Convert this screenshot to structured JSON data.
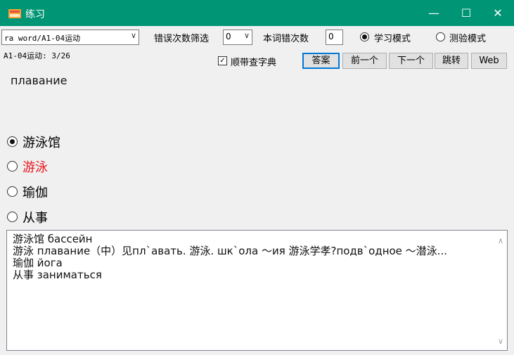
{
  "window": {
    "title": "练习",
    "minimize_glyph": "—",
    "maximize_glyph": "☐",
    "close_glyph": "✕"
  },
  "toolbar": {
    "word_list_selected": "ra word/A1-04运动",
    "error_filter_label": "错误次数筛选",
    "error_filter_value": "0",
    "word_error_count_label": "本词错次数",
    "word_error_count_value": "0",
    "mode_study_label": "学习模式",
    "mode_test_label": "测验模式",
    "mode_selected": "study"
  },
  "progress_text": "A1-04运动: 3/26",
  "dictionary_checkbox": {
    "label": "顺带查字典",
    "checked": true
  },
  "buttons": {
    "answer": "答案",
    "prev": "前一个",
    "next": "下一个",
    "jump": "跳转",
    "web": "Web"
  },
  "current_word": "плавание",
  "options": [
    {
      "text": "游泳馆",
      "selected": true
    },
    {
      "text": "游泳",
      "selected": false,
      "color": "#e8141b"
    },
    {
      "text": "瑜伽",
      "selected": false
    },
    {
      "text": "从事",
      "selected": false
    }
  ],
  "explanation_lines": [
    "游泳馆 бассейн",
    "游泳 плавание（中）见пл`авать. 游泳. шк`ола ～ия 游泳学孝?подв`одное ～潜泳...",
    "瑜伽 йога",
    "从事 заниматься"
  ],
  "colors": {
    "titlebar": "#009574",
    "wrong_option": "#e8141b",
    "focus_border": "#0078d7"
  },
  "icons": [
    "app-icon",
    "minimize-icon",
    "maximize-icon",
    "close-icon",
    "chevron-down-icon",
    "check-icon",
    "scroll-up-icon",
    "scroll-down-icon"
  ]
}
